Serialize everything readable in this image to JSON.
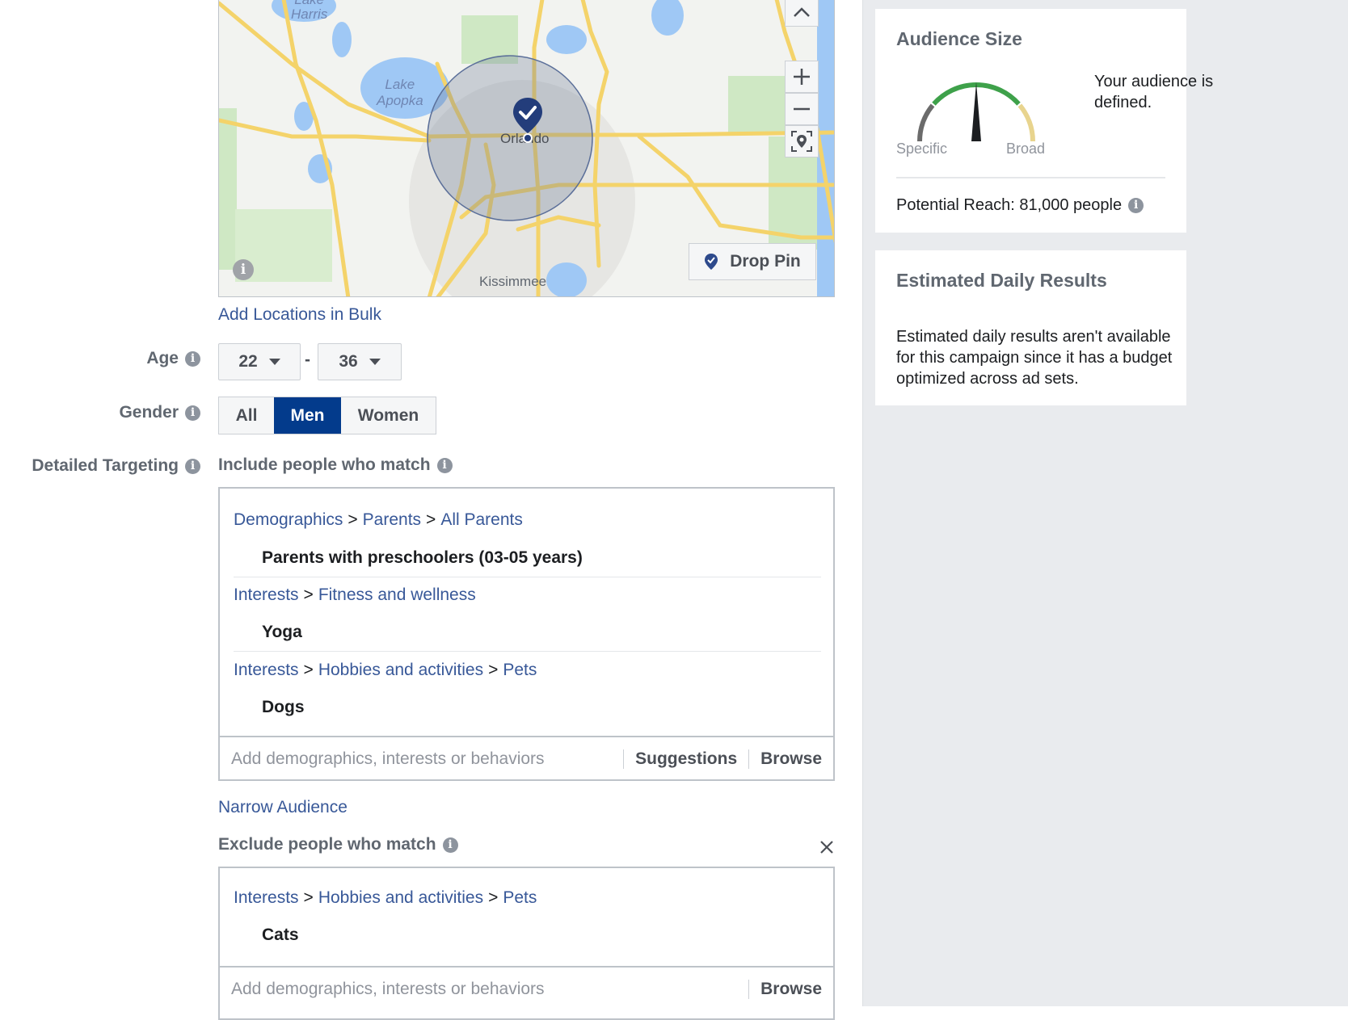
{
  "map": {
    "labels": {
      "lake_harris": "Lake Harris",
      "lake_harris_1": "Lake",
      "lake_harris_2": "Harris",
      "lake_apopka_1": "Lake",
      "lake_apopka_2": "Apopka",
      "orlando": "Orlando",
      "kissimmee": "Kissimmee"
    },
    "controls": {
      "collapse": "^",
      "zoom_in": "+",
      "zoom_out": "−"
    },
    "drop_pin_label": "Drop Pin"
  },
  "add_locations_bulk": "Add Locations in Bulk",
  "age": {
    "label": "Age",
    "min": "22",
    "separator": "-",
    "max": "36"
  },
  "gender": {
    "label": "Gender",
    "options": [
      "All",
      "Men",
      "Women"
    ],
    "selected": "Men"
  },
  "detailed_targeting": {
    "label": "Detailed Targeting",
    "include_label": "Include people who match",
    "include_items": [
      {
        "path": [
          "Demographics",
          "Parents",
          "All Parents"
        ],
        "item": "Parents with preschoolers (03-05 years)"
      },
      {
        "path": [
          "Interests",
          "Fitness and wellness"
        ],
        "item": "Yoga"
      },
      {
        "path": [
          "Interests",
          "Hobbies and activities",
          "Pets"
        ],
        "item": "Dogs"
      }
    ],
    "include_input_placeholder": "Add demographics, interests or behaviors",
    "suggestions_label": "Suggestions",
    "browse_label": "Browse",
    "separator": ">",
    "narrow_audience": "Narrow Audience",
    "exclude_label": "Exclude people who match",
    "exclude_items": [
      {
        "path": [
          "Interests",
          "Hobbies and activities",
          "Pets"
        ],
        "item": "Cats"
      }
    ],
    "exclude_input_placeholder": "Add demographics, interests or behaviors",
    "exclude_browse_label": "Browse"
  },
  "audience_size": {
    "title": "Audience Size",
    "status": "Your audience is defined.",
    "gauge_specific": "Specific",
    "gauge_broad": "Broad",
    "gauge_position": 0.5,
    "potential_reach": "Potential Reach: 81,000 people"
  },
  "estimated_daily": {
    "title": "Estimated Daily Results",
    "body": "Estimated daily results aren't available for this campaign since it has a budget optimized across ad sets."
  },
  "colors": {
    "link": "#385898",
    "selected": "#033b8c",
    "gauge_specific": "#6b6b6b",
    "gauge_good": "#3ea14a",
    "gauge_broad": "#e8d48e"
  }
}
